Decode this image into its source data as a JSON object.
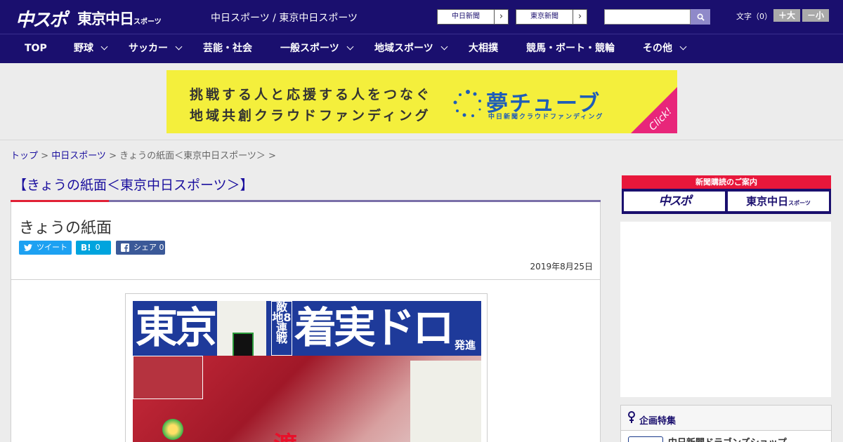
{
  "header": {
    "logo_chuspo": "中スポ",
    "logo_tokyo": "東京中日",
    "logo_tokyo_suffix": "スポーツ",
    "site_links": "中日スポーツ / 東京中日スポーツ",
    "btn_chunichi": "中日新聞",
    "btn_tokyo": "東京新聞",
    "arrow": "›",
    "search_placeholder": "",
    "font_label": "文字（0）",
    "font_big": "＋大",
    "font_small": "－小"
  },
  "nav": {
    "items": [
      {
        "label": "TOP",
        "dropdown": false
      },
      {
        "label": "野球",
        "dropdown": true
      },
      {
        "label": "サッカー",
        "dropdown": true
      },
      {
        "label": "芸能・社会",
        "dropdown": false
      },
      {
        "label": "一般スポーツ",
        "dropdown": true
      },
      {
        "label": "地域スポーツ",
        "dropdown": true
      },
      {
        "label": "大相撲",
        "dropdown": false
      },
      {
        "label": "競馬・ボート・競輪",
        "dropdown": false
      },
      {
        "label": "その他",
        "dropdown": true
      }
    ]
  },
  "banner": {
    "line1": "挑戦する人と応援する人をつなぐ",
    "line2": "地域共創クラウドファンディング",
    "brand": "夢チューブ",
    "brand_sub": "中日新聞クラウドファンディング",
    "click": "Click!"
  },
  "breadcrumb": {
    "home": "トップ",
    "sep": " > ",
    "section": "中日スポーツ",
    "current": "きょうの紙面＜東京中日スポーツ＞"
  },
  "article": {
    "section_title": "【きょうの紙面＜東京中日スポーツ＞】",
    "title": "きょうの紙面",
    "share_tweet": "ツイート",
    "share_hatena_icon": "B!",
    "share_hatena_count": "0",
    "share_fb": "シェア",
    "share_fb_count": "0",
    "date": "2019年8月25日"
  },
  "newspaper": {
    "headline_left": "東京",
    "headline_right": "着実ドロー",
    "tekichi": "敵地8連戦",
    "hassin": "発進",
    "photo_caption": "渡"
  },
  "sidebar": {
    "subscribe_title": "新聞購読のご案内",
    "sub_chuspo": "中スポ",
    "sub_tokyo": "東京中日",
    "sub_tokyo_suffix": "スポーツ",
    "feature_title": "企画特集",
    "feature_item": "中日新聞ドラゴンズショップ"
  },
  "colors": {
    "header_bg": "#1a0f6e",
    "accent_red": "#e12035",
    "link": "#1a0f9e",
    "banner_yellow": "#f4ef3c",
    "twitter": "#1da1f2",
    "hatena": "#00a4de",
    "facebook": "#3b5998"
  }
}
